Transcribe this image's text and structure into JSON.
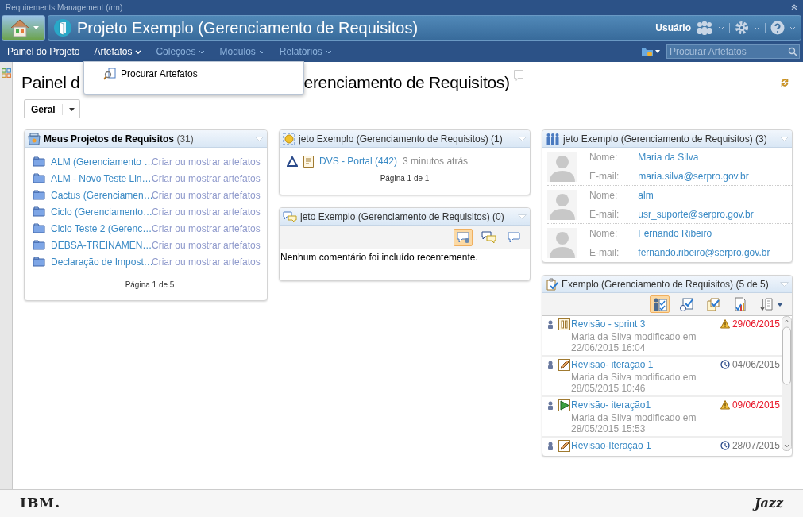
{
  "app_title": "Requirements Management (/rm)",
  "banner": {
    "title": "Projeto Exemplo (Gerenciamento de Requisitos)",
    "user_label": "Usuário"
  },
  "nav": [
    {
      "label": "Painel do Projeto",
      "highlighted": true,
      "expanded": false
    },
    {
      "label": "Artefatos",
      "highlighted": true,
      "expanded": true
    },
    {
      "label": "Coleções",
      "highlighted": false,
      "expanded": false
    },
    {
      "label": "Módulos",
      "highlighted": false,
      "expanded": false
    },
    {
      "label": "Relatórios",
      "highlighted": false,
      "expanded": false
    }
  ],
  "search": {
    "placeholder": "Procurar Artefatos"
  },
  "menu": {
    "items": [
      "Procurar Artefatos"
    ]
  },
  "page_title": {
    "before": "Painel d",
    "after": "erenciamento de Requisitos)"
  },
  "tabs": [
    {
      "label": "Geral",
      "selected": true
    }
  ],
  "projects": {
    "title": "Meus Projetos de Requisitos",
    "count": "(31)",
    "rows": [
      {
        "name": "ALM (Gerenciamento …",
        "action": "Criar ou mostrar artefatos"
      },
      {
        "name": "ALM - Novo Teste Lin…",
        "action": "Criar ou mostrar artefatos"
      },
      {
        "name": "Cactus (Gerenciamen…",
        "action": "Criar ou mostrar artefatos"
      },
      {
        "name": "Ciclo (Gerenciamento…",
        "action": "Criar ou mostrar artefatos"
      },
      {
        "name": "Ciclo Teste 2 (Gerenc…",
        "action": "Criar ou mostrar artefatos"
      },
      {
        "name": "DEBSA-TREINAMEN…",
        "action": "Criar ou mostrar artefatos"
      },
      {
        "name": "Declaração de Impost…",
        "action": "Criar ou mostrar artefatos"
      }
    ],
    "pager": "Página 1 de 5"
  },
  "changes": {
    "title": "jeto Exemplo (Gerenciamento de Requisitos) (1)",
    "rows": [
      {
        "name": "DVS - Portal (442)",
        "time": "3 minutos atrás"
      }
    ],
    "pager": "Página 1 de 1"
  },
  "comments": {
    "title": "jeto Exemplo (Gerenciamento de Requisitos) (0)",
    "filters": [
      {
        "selected": true
      },
      {
        "selected": false
      },
      {
        "selected": false
      }
    ],
    "message": "Nenhum comentário foi incluído recentemente."
  },
  "members": {
    "title": "jeto Exemplo (Gerenciamento de Requisitos) (3)",
    "rows": [
      {
        "name_label": "Nome:",
        "name": "Maria da Silva",
        "email_label": "E-mail:",
        "email": "maria.silva@serpro.gov.br"
      },
      {
        "name_label": "Nome:",
        "name": "alm",
        "email_label": "E-mail:",
        "email": "usr_suporte@serpro.gov.br"
      },
      {
        "name_label": "Nome:",
        "name": "Fernando Ribeiro",
        "email_label": "E-mail:",
        "email": "fernando.ribeiro@serpro.gov.br"
      }
    ]
  },
  "reviews": {
    "title": "Exemplo (Gerenciamento de Requisitos) (5 de 5)",
    "filters": [
      {
        "selected": true
      },
      {
        "selected": false
      },
      {
        "selected": false
      },
      {
        "selected": false
      },
      {
        "selected": false
      }
    ],
    "rows": [
      {
        "kind": "paused",
        "name": "Revisão - sprint 3",
        "overdue": true,
        "date": "29/06/2015",
        "detail": "Maria da Silva modificado em 22/06/2015 16:04"
      },
      {
        "kind": "draft",
        "name": "Revisão- iteração 1",
        "overdue": false,
        "date": "04/06/2015",
        "detail": "Maria da Silva modificado em 28/05/2015 10:46"
      },
      {
        "kind": "running",
        "name": "Revisão- iteração1",
        "overdue": true,
        "date": "09/06/2015",
        "detail": "Maria da Silva modificado em 28/05/2015 15:53"
      },
      {
        "kind": "draft",
        "name": "Revisão-Iteração 1",
        "overdue": false,
        "date": "28/07/2015"
      }
    ]
  },
  "footer": {
    "left_logo": "IBM.",
    "right_logo": "Jazz"
  }
}
